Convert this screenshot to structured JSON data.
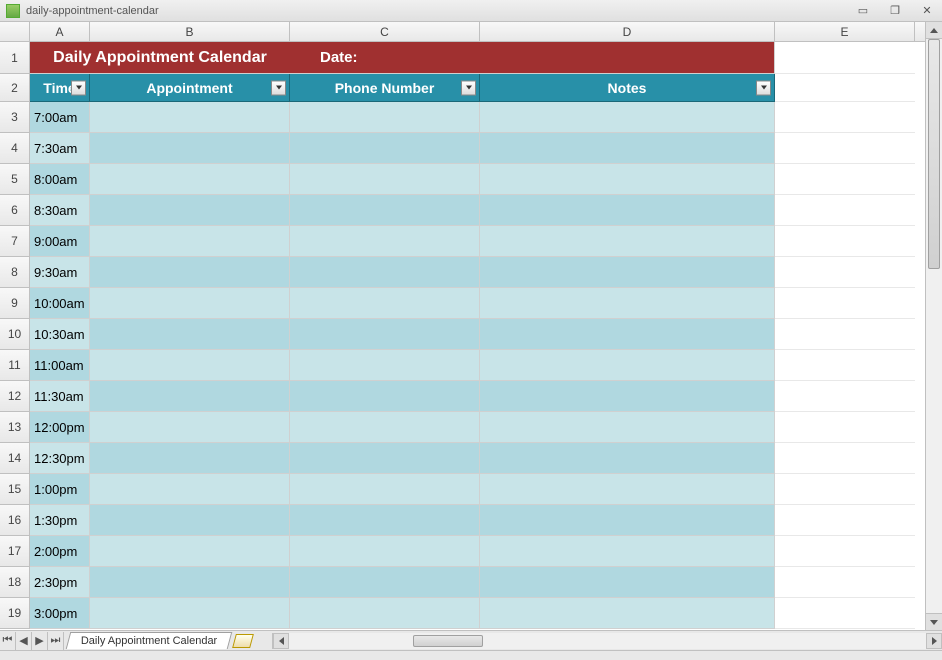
{
  "window": {
    "title": "daily-appointment-calendar"
  },
  "columns": [
    "A",
    "B",
    "C",
    "D",
    "E"
  ],
  "title_row": {
    "left": "Daily Appointment Calendar",
    "date_label": "Date:"
  },
  "headers": {
    "time": "Time",
    "appointment": "Appointment",
    "phone": "Phone Number",
    "notes": "Notes"
  },
  "rows": [
    {
      "num": 3,
      "time": "7:00am",
      "appointment": "",
      "phone": "",
      "notes": ""
    },
    {
      "num": 4,
      "time": "7:30am",
      "appointment": "",
      "phone": "",
      "notes": ""
    },
    {
      "num": 5,
      "time": "8:00am",
      "appointment": "",
      "phone": "",
      "notes": ""
    },
    {
      "num": 6,
      "time": "8:30am",
      "appointment": "",
      "phone": "",
      "notes": ""
    },
    {
      "num": 7,
      "time": "9:00am",
      "appointment": "",
      "phone": "",
      "notes": ""
    },
    {
      "num": 8,
      "time": "9:30am",
      "appointment": "",
      "phone": "",
      "notes": ""
    },
    {
      "num": 9,
      "time": "10:00am",
      "appointment": "",
      "phone": "",
      "notes": ""
    },
    {
      "num": 10,
      "time": "10:30am",
      "appointment": "",
      "phone": "",
      "notes": ""
    },
    {
      "num": 11,
      "time": "11:00am",
      "appointment": "",
      "phone": "",
      "notes": ""
    },
    {
      "num": 12,
      "time": "11:30am",
      "appointment": "",
      "phone": "",
      "notes": ""
    },
    {
      "num": 13,
      "time": "12:00pm",
      "appointment": "",
      "phone": "",
      "notes": ""
    },
    {
      "num": 14,
      "time": "12:30pm",
      "appointment": "",
      "phone": "",
      "notes": ""
    },
    {
      "num": 15,
      "time": "1:00pm",
      "appointment": "",
      "phone": "",
      "notes": ""
    },
    {
      "num": 16,
      "time": "1:30pm",
      "appointment": "",
      "phone": "",
      "notes": ""
    },
    {
      "num": 17,
      "time": "2:00pm",
      "appointment": "",
      "phone": "",
      "notes": ""
    },
    {
      "num": 18,
      "time": "2:30pm",
      "appointment": "",
      "phone": "",
      "notes": ""
    },
    {
      "num": 19,
      "time": "3:00pm",
      "appointment": "",
      "phone": "",
      "notes": ""
    }
  ],
  "sheet_tab": {
    "name": "Daily Appointment Calendar"
  }
}
